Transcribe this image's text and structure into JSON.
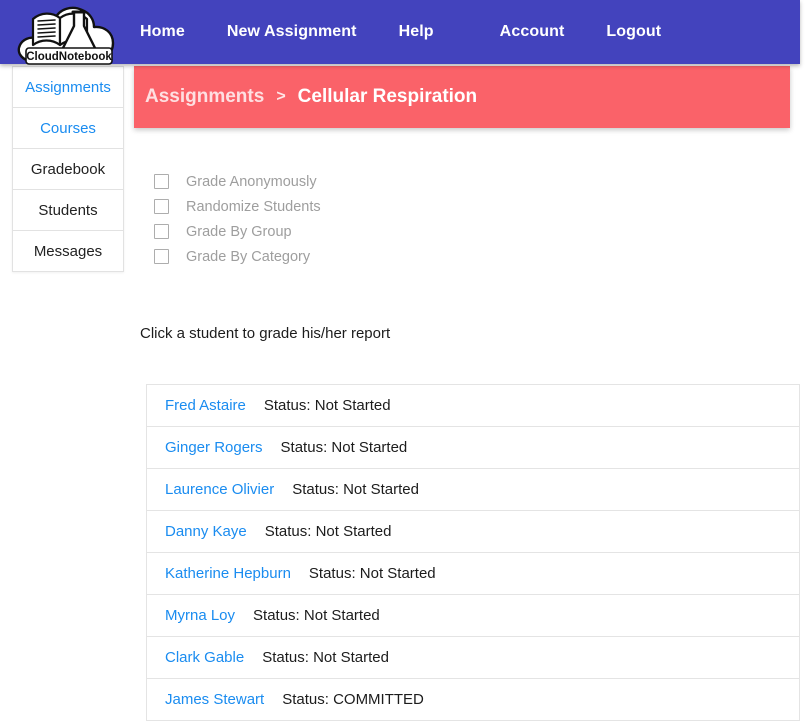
{
  "brand": {
    "logo_text": "CloudNotebook",
    "logo_icon": "cloud-book-flask-logo"
  },
  "navbar": {
    "items": [
      {
        "label": "Home"
      },
      {
        "label": "New Assignment"
      },
      {
        "label": "Help"
      },
      {
        "label": "Account"
      },
      {
        "label": "Logout"
      }
    ],
    "background_color": "#4343bd"
  },
  "banner": {
    "crumb": "Assignments",
    "separator": ">",
    "current": "Cellular Respiration",
    "background_color": "#fa6269"
  },
  "sidebar": {
    "items": [
      {
        "label": "Assignments",
        "style": "link"
      },
      {
        "label": "Courses",
        "style": "link"
      },
      {
        "label": "Gradebook",
        "style": "plain"
      },
      {
        "label": "Students",
        "style": "plain"
      },
      {
        "label": "Messages",
        "style": "plain"
      }
    ]
  },
  "options": {
    "items": [
      {
        "label": "Grade Anonymously",
        "checked": false
      },
      {
        "label": "Randomize Students",
        "checked": false
      },
      {
        "label": "Grade By Group",
        "checked": false
      },
      {
        "label": "Grade By Category",
        "checked": false
      }
    ]
  },
  "main": {
    "hint": "Click a student to grade his/her report",
    "students": [
      {
        "name": "Fred Astaire",
        "status": "Status: Not Started"
      },
      {
        "name": "Ginger Rogers",
        "status": "Status: Not Started"
      },
      {
        "name": "Laurence Olivier",
        "status": "Status: Not Started"
      },
      {
        "name": "Danny Kaye",
        "status": "Status: Not Started"
      },
      {
        "name": "Katherine Hepburn",
        "status": "Status: Not Started"
      },
      {
        "name": "Myrna Loy",
        "status": "Status: Not Started"
      },
      {
        "name": "Clark Gable",
        "status": "Status: Not Started"
      },
      {
        "name": "James Stewart",
        "status": "Status: COMMITTED"
      }
    ]
  },
  "colors": {
    "link_blue": "#1a8cf0",
    "nav_purple": "#4343bd",
    "banner_coral": "#fa6269",
    "muted_gray": "#9e9e9e"
  }
}
